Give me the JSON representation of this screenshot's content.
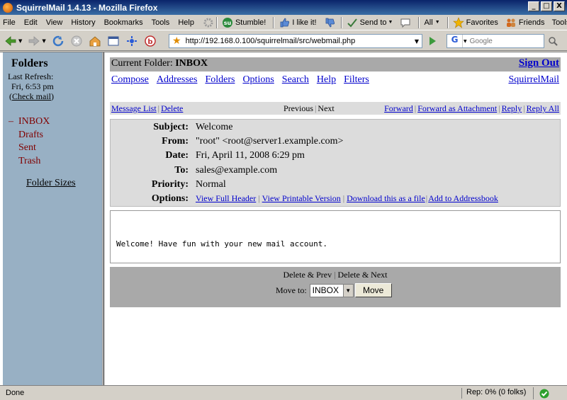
{
  "window": {
    "title": "SquirrelMail 1.4.13 - Mozilla Firefox",
    "minimize": "_",
    "maximize": "□",
    "close": "X"
  },
  "menubar": {
    "items": [
      "File",
      "Edit",
      "View",
      "History",
      "Bookmarks",
      "Tools",
      "Help"
    ],
    "stumble": "Stumble!",
    "like": "I like it!",
    "sendto": "Send to",
    "all": "All",
    "favorites": "Favorites",
    "friends": "Friends",
    "tools": "Tools"
  },
  "navbar": {
    "url": "http://192.168.0.100/squirrelmail/src/webmail.php",
    "search_placeholder": "Google"
  },
  "sidebar": {
    "title": "Folders",
    "last_refresh_label": "Last Refresh:",
    "last_refresh_time": "Fri, 6:53 pm",
    "check_mail": "Check mail",
    "folders": [
      "INBOX",
      "Drafts",
      "Sent",
      "Trash"
    ],
    "folder_sizes": "Folder Sizes"
  },
  "header": {
    "current_folder_label": "Current Folder:",
    "current_folder": "INBOX",
    "sign_out": "Sign Out",
    "nav": [
      "Compose",
      "Addresses",
      "Folders",
      "Options",
      "Search",
      "Help",
      "Filters"
    ],
    "brand": "SquirrelMail"
  },
  "message_bar": {
    "message_list": "Message List",
    "delete": "Delete",
    "previous": "Previous",
    "next": "Next",
    "forward": "Forward",
    "forward_attachment": "Forward as Attachment",
    "reply": "Reply",
    "reply_all": "Reply All"
  },
  "message": {
    "subject_label": "Subject:",
    "subject": "Welcome",
    "from_label": "From:",
    "from": "\"root\" <root@server1.example.com>",
    "date_label": "Date:",
    "date": "Fri, April 11, 2008 6:29 pm",
    "to_label": "To:",
    "to": "sales@example.com",
    "priority_label": "Priority:",
    "priority": "Normal",
    "options_label": "Options:",
    "options": [
      "View Full Header",
      "View Printable Version",
      "Download this as a file",
      "Add to Addressbook"
    ],
    "body": "Welcome! Have fun with your new mail account."
  },
  "bottom": {
    "delete_prev": "Delete & Prev",
    "delete_next": "Delete & Next",
    "move_to": "Move to:",
    "move_folder": "INBOX",
    "move_button": "Move"
  },
  "status": {
    "text": "Done",
    "rep": "Rep: 0% (0 folks)"
  }
}
